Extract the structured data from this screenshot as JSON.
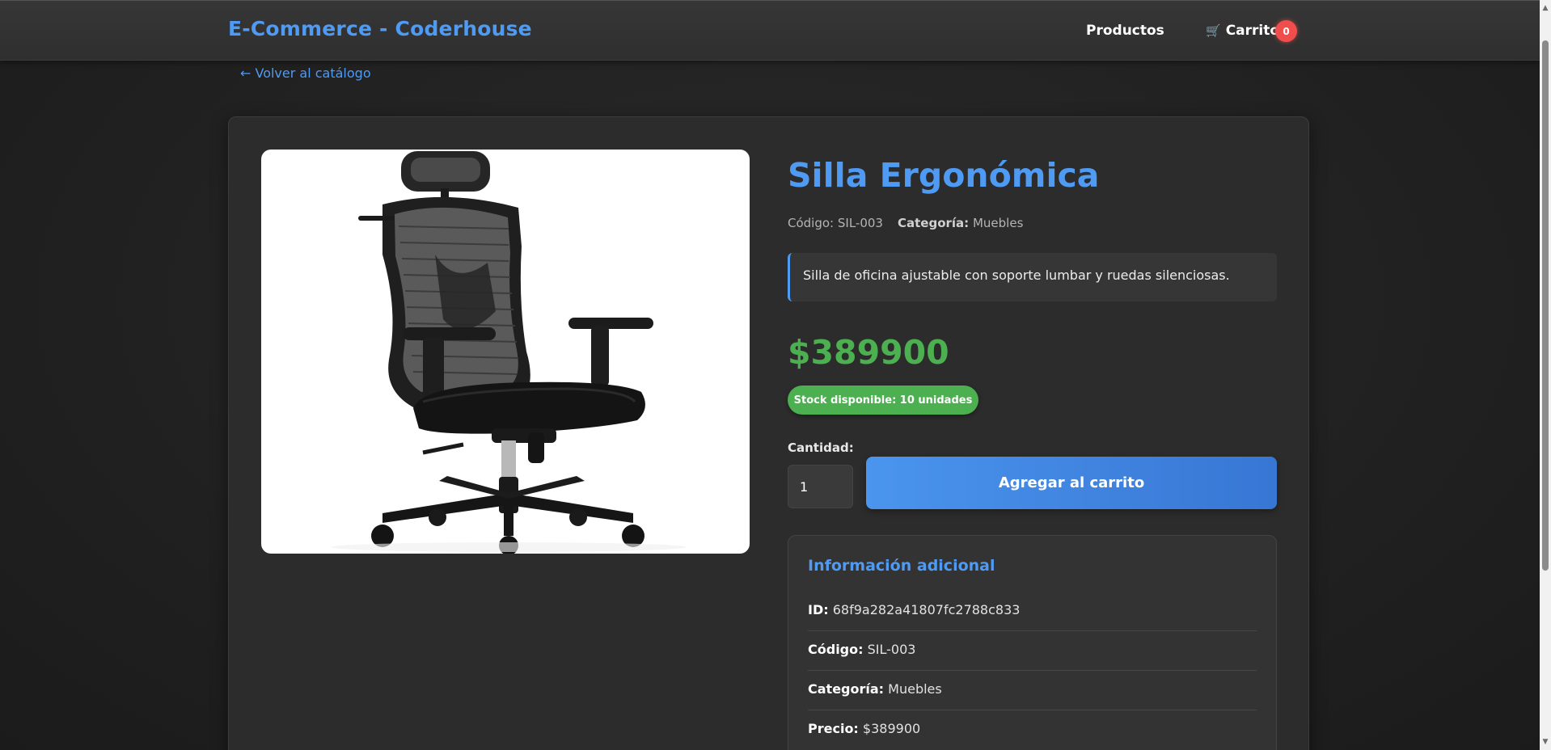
{
  "header": {
    "brand": "E-Commerce - Coderhouse",
    "nav_products": "Productos",
    "cart_icon": "shopping-cart-icon",
    "cart_label": "Carrito",
    "cart_count": "0"
  },
  "back_link": "← Volver al catálogo",
  "product": {
    "title": "Silla Ergonómica",
    "code_label": "Código:",
    "code": "SIL-003",
    "category_label": "Categoría:",
    "category": "Muebles",
    "description": "Silla de oficina ajustable con soporte lumbar y ruedas silenciosas.",
    "price": "$389900",
    "stock_text": "Stock disponible: 10 unidades",
    "image_alt": "ergonomic office chair photo"
  },
  "purchase": {
    "quantity_label": "Cantidad:",
    "quantity_value": "1",
    "add_button": "Agregar al carrito"
  },
  "additional_info": {
    "title": "Información adicional",
    "rows": [
      {
        "label": "ID:",
        "value": "68f9a282a41807fc2788c833"
      },
      {
        "label": "Código:",
        "value": "SIL-003"
      },
      {
        "label": "Categoría:",
        "value": "Muebles"
      },
      {
        "label": "Precio:",
        "value": "$389900"
      }
    ]
  },
  "colors": {
    "accent": "#4f9af2",
    "price_green": "#4caf50",
    "badge_red": "#f04d4d",
    "background": "#222222"
  }
}
